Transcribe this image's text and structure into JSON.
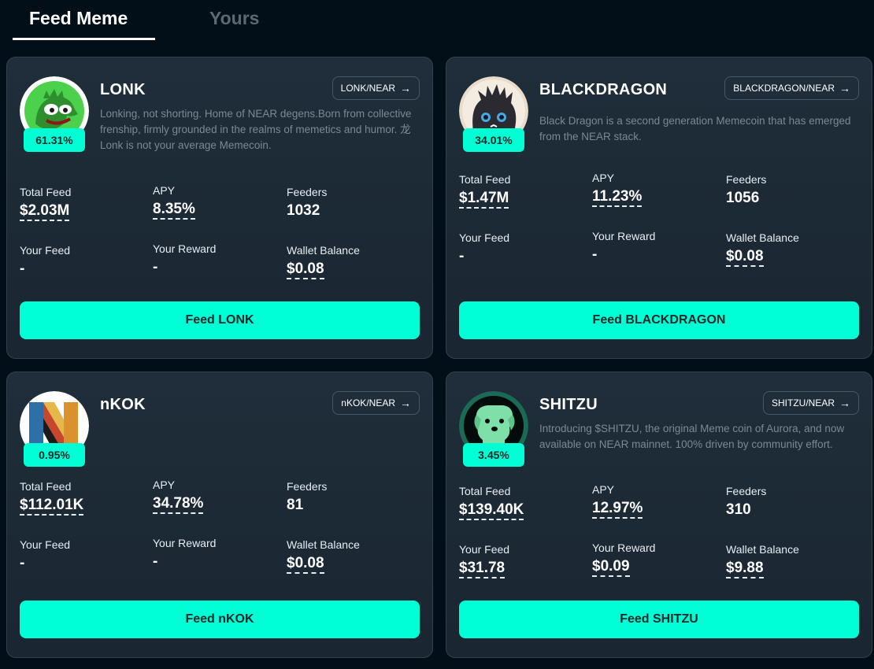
{
  "tabs": {
    "feed_meme": "Feed Meme",
    "yours": "Yours"
  },
  "labels": {
    "total_feed": "Total Feed",
    "apy": "APY",
    "feeders": "Feeders",
    "your_feed": "Your Feed",
    "your_reward": "Your Reward",
    "wallet_balance": "Wallet Balance"
  },
  "cards": [
    {
      "name": "LONK",
      "pair": "LONK/NEAR",
      "badge": "61.31%",
      "description": "Lonking, not shorting. Home of NEAR degens.Born from collective frenship, firmly grounded in the realms of memetics and humor. 龙 Lonk is not your average Memecoin.",
      "total_feed": "$2.03M",
      "apy": "8.35%",
      "feeders": "1032",
      "your_feed": "-",
      "your_reward": "-",
      "wallet_balance": "$0.08",
      "button": "Feed LONK",
      "logo_icon": "green-frog-logo-icon"
    },
    {
      "name": "BLACKDRAGON",
      "pair": "BLACKDRAGON/NEAR",
      "badge": "34.01%",
      "description": "Black Dragon is a second generation Memecoin that has emerged from the NEAR stack.",
      "total_feed": "$1.47M",
      "apy": "11.23%",
      "feeders": "1056",
      "your_feed": "-",
      "your_reward": "-",
      "wallet_balance": "$0.08",
      "button": "Feed BLACKDRAGON",
      "logo_icon": "black-dragon-logo-icon"
    },
    {
      "name": "nKOK",
      "pair": "nKOK/NEAR",
      "badge": "0.95%",
      "description": "",
      "total_feed": "$112.01K",
      "apy": "34.78%",
      "feeders": "81",
      "your_feed": "-",
      "your_reward": "-",
      "wallet_balance": "$0.08",
      "button": "Feed nKOK",
      "logo_icon": "nkok-letter-logo-icon"
    },
    {
      "name": "SHITZU",
      "pair": "SHITZU/NEAR",
      "badge": "3.45%",
      "description": "Introducing $SHITZU, the original Meme coin of Aurora, and now available on NEAR mainnet. 100% driven by community effort.",
      "total_feed": "$139.40K",
      "apy": "12.97%",
      "feeders": "310",
      "your_feed": "$31.78",
      "your_reward": "$0.09",
      "wallet_balance": "$9.88",
      "button": "Feed SHITZU",
      "logo_icon": "green-dog-logo-icon"
    }
  ],
  "colors": {
    "accent": "#00ffd5",
    "background": "#020f18",
    "card": "#1d2b36"
  }
}
